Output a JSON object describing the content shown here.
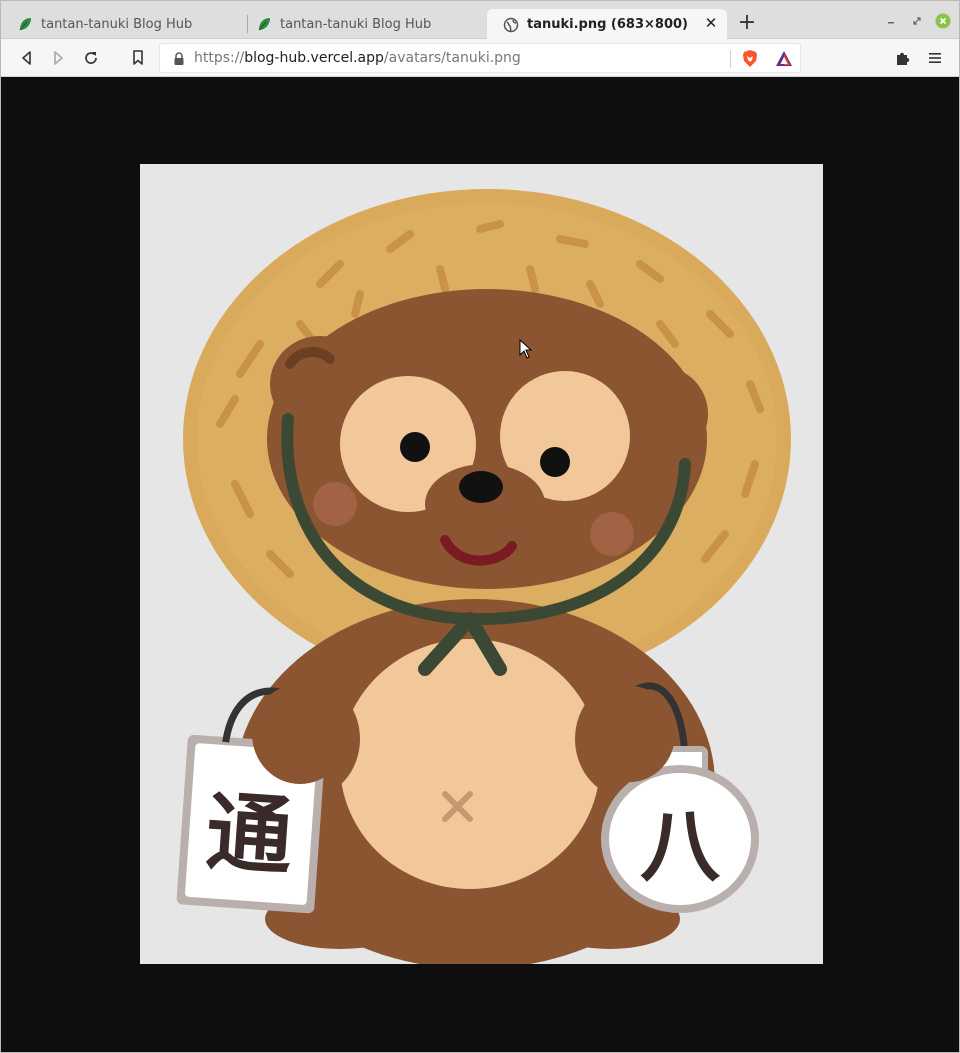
{
  "tabs": [
    {
      "label": "tantan-tanuki Blog Hub",
      "icon": "leaf-icon",
      "active": false
    },
    {
      "label": "tantan-tanuki Blog Hub",
      "icon": "leaf-icon",
      "active": false
    },
    {
      "label": "tanuki.png (683×800)",
      "icon": "globe-icon",
      "active": true
    }
  ],
  "address": {
    "scheme": "https://",
    "host": "blog-hub.vercel.app",
    "path": "/avatars/tanuki.png"
  },
  "image": {
    "alt": "tanuki.png",
    "characters": {
      "left_sign": "通",
      "right_lantern": "八"
    }
  },
  "colors": {
    "accent_leaf": "#2e8b3e",
    "brave_orange": "#fb542b",
    "close_green": "#8bc34a"
  }
}
